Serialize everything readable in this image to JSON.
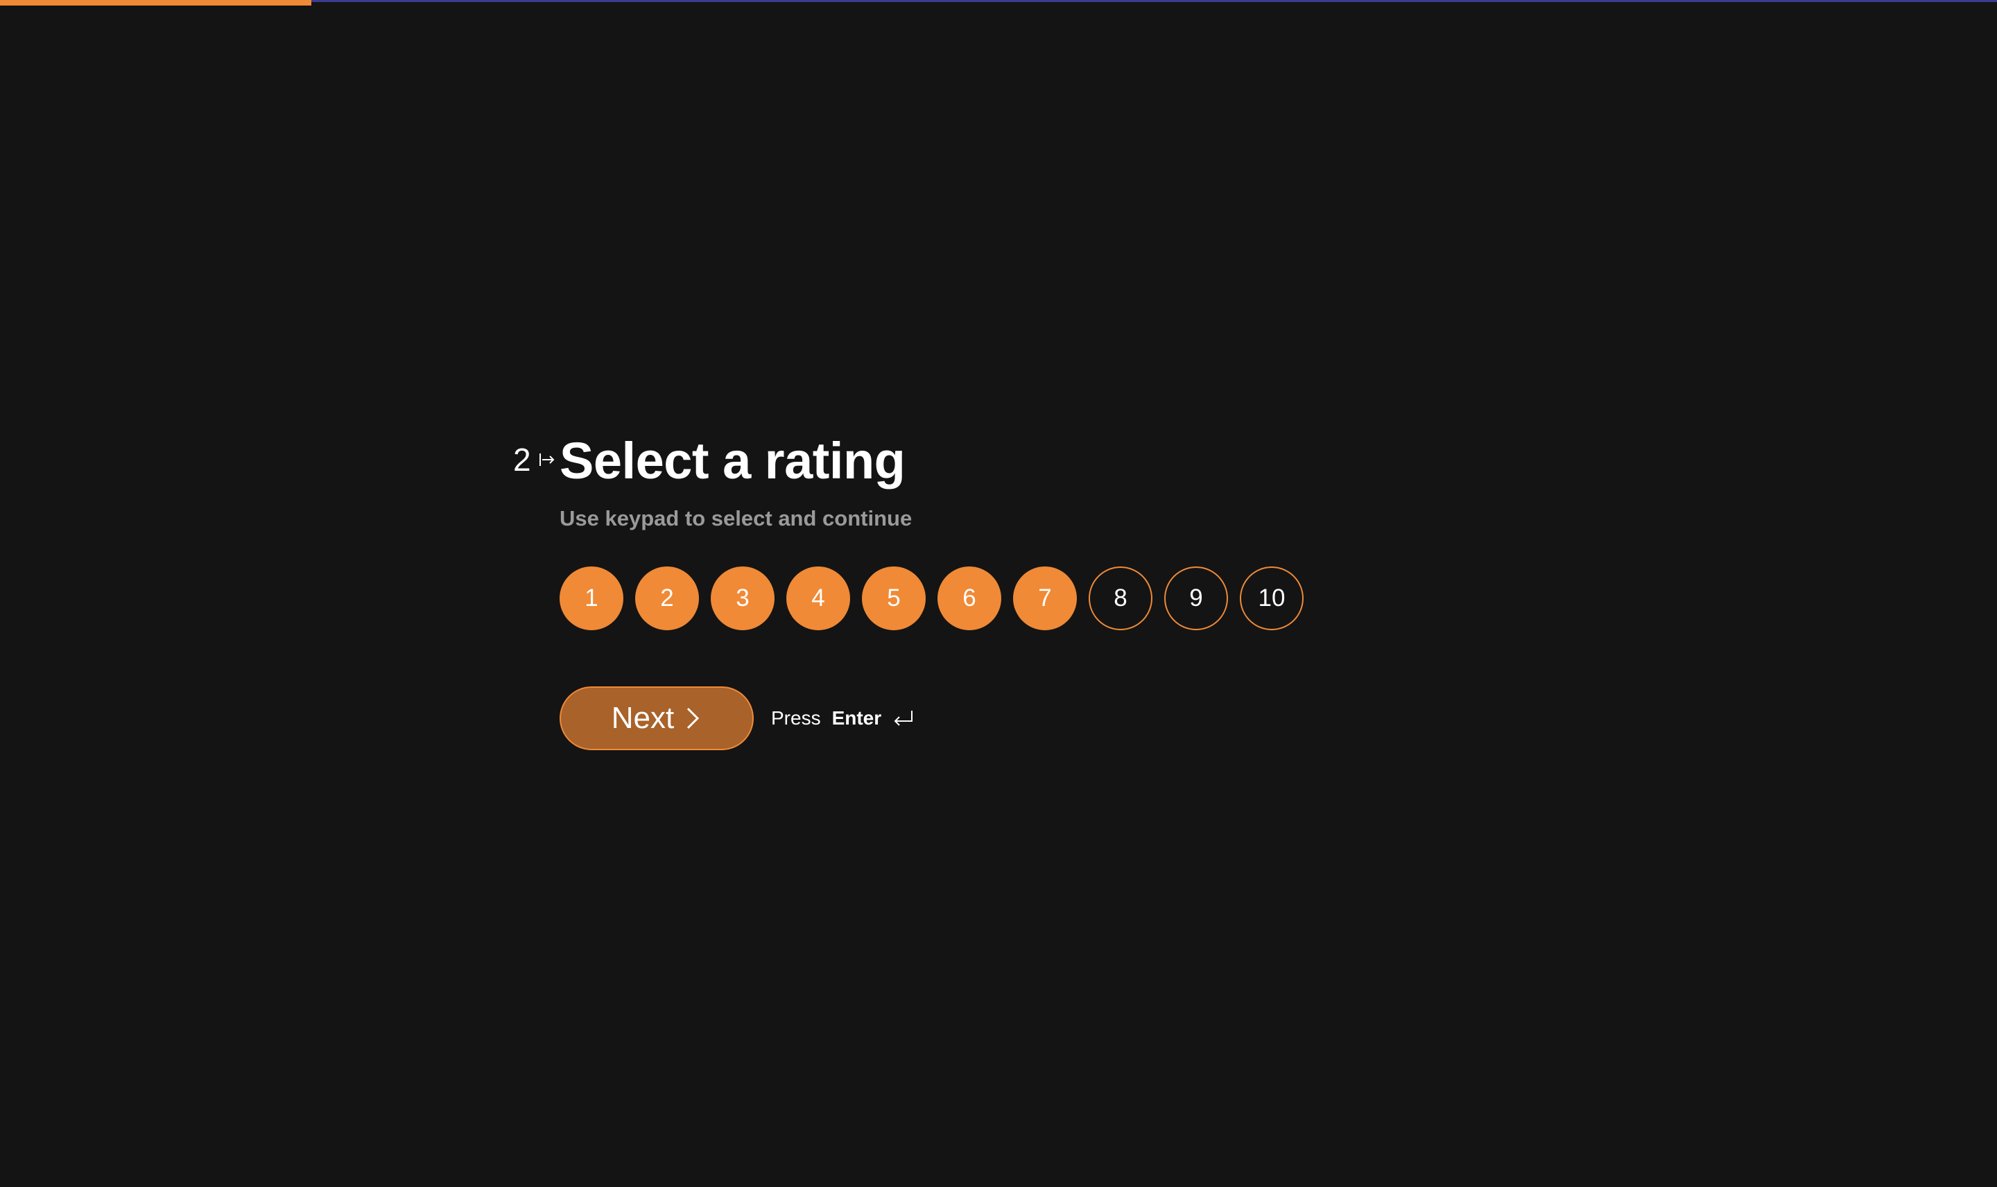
{
  "progress": {
    "fraction": 0.156,
    "fill_color": "#f08a36",
    "track_color": "#3b3b8f"
  },
  "question": {
    "number": "2",
    "number_icon": "arrow-right-icon",
    "title": "Select a rating",
    "subtitle": "Use keypad to select and continue"
  },
  "rating": {
    "options": [
      "1",
      "2",
      "3",
      "4",
      "5",
      "6",
      "7",
      "8",
      "9",
      "10"
    ],
    "selected_value": 7,
    "accent_color": "#f08a36"
  },
  "actions": {
    "next_label": "Next",
    "next_icon": "chevron-right-icon",
    "hint_prefix": "Press",
    "hint_key": "Enter",
    "hint_icon": "enter-key-icon"
  },
  "colors": {
    "background": "#141414",
    "button_fill": "#a8622a",
    "subtitle": "#9a9a9a"
  }
}
